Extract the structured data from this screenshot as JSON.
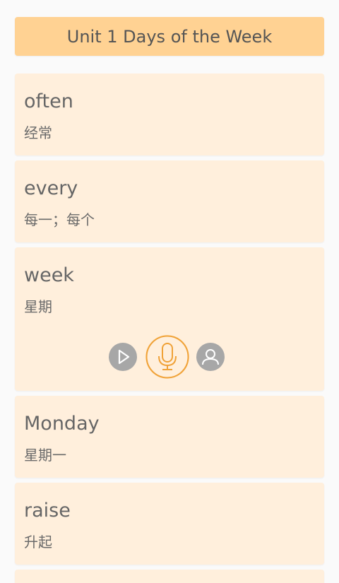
{
  "header": {
    "title": "Unit 1 Days of the Week"
  },
  "cards": [
    {
      "word": "often",
      "meaning": "经常"
    },
    {
      "word": "every",
      "meaning": "每一；每个"
    },
    {
      "word": "week",
      "meaning": "星期"
    },
    {
      "word": "Monday",
      "meaning": "星期一"
    },
    {
      "word": "raise",
      "meaning": "升起"
    }
  ],
  "controls": {
    "play_icon": "play-icon",
    "mic_icon": "microphone-icon",
    "user_icon": "user-icon"
  },
  "colors": {
    "header_bg": "#ffd293",
    "card_bg": "#ffefdc",
    "accent": "#f0a238",
    "icon_grey": "#a7a7a7"
  }
}
